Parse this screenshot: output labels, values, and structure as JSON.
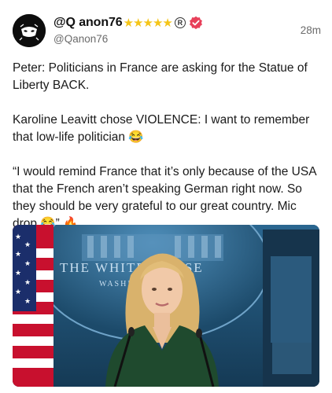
{
  "author": {
    "display_name": "@Q anon76",
    "stars": "★★★★★",
    "registered_mark": "R",
    "handle": "@Qanon76"
  },
  "post": {
    "timestamp": "28m",
    "paragraphs": [
      "Peter: Politicians in France are asking for the Statue of Liberty BACK.",
      "Karoline Leavitt chose VIOLENCE: I want to remember that low-life politician 😂",
      "“I would remind France that it’s only because of the USA that the French aren’t speaking German right now. So they should be very grateful to our great country. Mic drop 😂” 🔥"
    ]
  },
  "media": {
    "backdrop_text_line1": "THE WHITE HOUSE",
    "backdrop_text_line2": "WASHINGTON"
  },
  "colors": {
    "verified": "#e8405a",
    "stars": "#f5c518",
    "backdrop": "#1d4b6b",
    "dress": "#1f4a2e"
  },
  "icons": {
    "avatar": "mask-logo-icon",
    "verified": "verified-badge-icon",
    "registered": "registered-mark-icon"
  }
}
